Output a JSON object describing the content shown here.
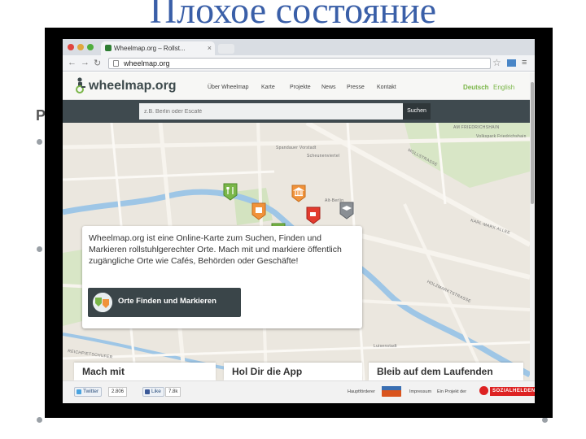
{
  "slide": {
    "title": "Плохое состояние",
    "left_letter": "Р"
  },
  "browser": {
    "tab_title": "Wheelmap.org – Rollst...",
    "tab_close": "×",
    "url": "wheelmap.org",
    "back": "←",
    "forward": "→",
    "reload": "↻",
    "star": "☆",
    "menu": "≡",
    "colors": {
      "chrome": "#d9dde3",
      "close_dot": "#e0443e",
      "min_dot": "#e1a73d",
      "max_dot": "#4fae3c"
    }
  },
  "site": {
    "logo_text": "wheelmap.org",
    "nav": [
      "Über Wheelmap",
      "Karte",
      "Projekte",
      "News",
      "Presse",
      "Kontakt"
    ],
    "lang_active": "Deutsch",
    "lang_other": "English",
    "search_placeholder": "z.B. Berlin oder Escafé",
    "search_button": "Suchen",
    "colors": {
      "accent_green": "#7ab648",
      "header_dark": "#3f4a4f"
    }
  },
  "map": {
    "streets": [
      "AM FRIEDRICHSHAIN",
      "MOLLSTRASSE",
      "KARL-MARX-ALLEE",
      "HOLZMARKTSTRASSE",
      "REICHPIETSCHUFER",
      "Spandauer Vorstadt",
      "Scheunenviertel",
      "Alt-Berlin",
      "Luisenstadt",
      "Volkspark Friedrichshain"
    ],
    "markers": [
      "restaurant-marker",
      "shopping-marker",
      "museum-marker",
      "cafe-marker",
      "education-marker",
      "restaurant-marker",
      "clothing-marker",
      "library-marker"
    ]
  },
  "info": {
    "text": "Wheelmap.org ist eine Online-Karte zum Suchen, Finden und Markieren rollstuhlgerechter Orte. Mach mit und markiere öffentlich zugängliche Orte wie Cafés, Behörden oder Geschäfte!",
    "cta": "Orte Finden und Markieren"
  },
  "cards": [
    "Mach mit",
    "Hol Dir die App",
    "Bleib auf dem Laufenden"
  ],
  "footer": {
    "twitter": "Twitter",
    "twitter_count": "2.806",
    "like": "Like",
    "like_count": "7.8k",
    "sponsor_label": "Hauptförderer",
    "impressum": "Impressum",
    "project_of": "Ein Projekt der",
    "sozialhelden": "SOZIALHELDEN"
  }
}
